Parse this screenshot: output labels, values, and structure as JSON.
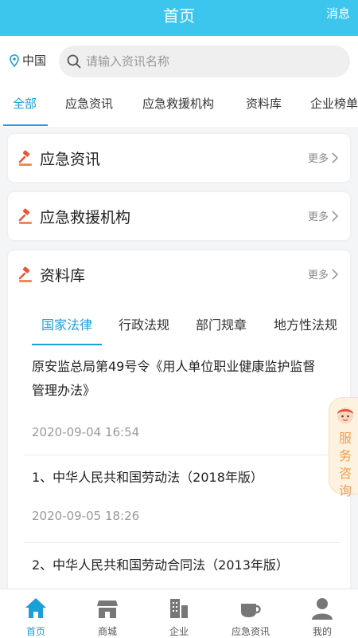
{
  "header": {
    "title": "首页",
    "message_label": "消息"
  },
  "location": {
    "name": "中国"
  },
  "search": {
    "placeholder": "请输入资讯名称"
  },
  "tabs": [
    {
      "label": "全部",
      "active": true
    },
    {
      "label": "应急资讯"
    },
    {
      "label": "应急救援机构"
    },
    {
      "label": "资料库"
    },
    {
      "label": "企业榜单"
    }
  ],
  "sections": [
    {
      "title": "应急资讯",
      "more": "更多"
    },
    {
      "title": "应急救援机构",
      "more": "更多"
    },
    {
      "title": "资料库",
      "more": "更多"
    }
  ],
  "library": {
    "subtabs": [
      {
        "label": "国家法律",
        "active": true
      },
      {
        "label": "行政法规"
      },
      {
        "label": "部门规章"
      },
      {
        "label": "地方性法规"
      }
    ],
    "items": [
      {
        "title": "原安监总局第49号令《用人单位职业健康监护监督管理办法》",
        "date": "2020-09-04 16:54"
      },
      {
        "title": "1、中华人民共和国劳动法（2018年版）",
        "date": "2020-09-05 18:26"
      },
      {
        "title": "2、中华人民共和国劳动合同法（2013年版）",
        "date": ""
      }
    ]
  },
  "service": {
    "label": "服务咨询"
  },
  "bottom_nav": [
    {
      "label": "首页",
      "icon": "home-icon",
      "active": true
    },
    {
      "label": "商城",
      "icon": "shop-icon"
    },
    {
      "label": "企业",
      "icon": "building-icon"
    },
    {
      "label": "应急资讯",
      "icon": "cup-icon"
    },
    {
      "label": "我的",
      "icon": "user-icon"
    }
  ],
  "colors": {
    "primary": "#3cc6ee",
    "active": "#1a9fd6",
    "accent_icon": "#e8553a",
    "service": "#f0a050"
  }
}
